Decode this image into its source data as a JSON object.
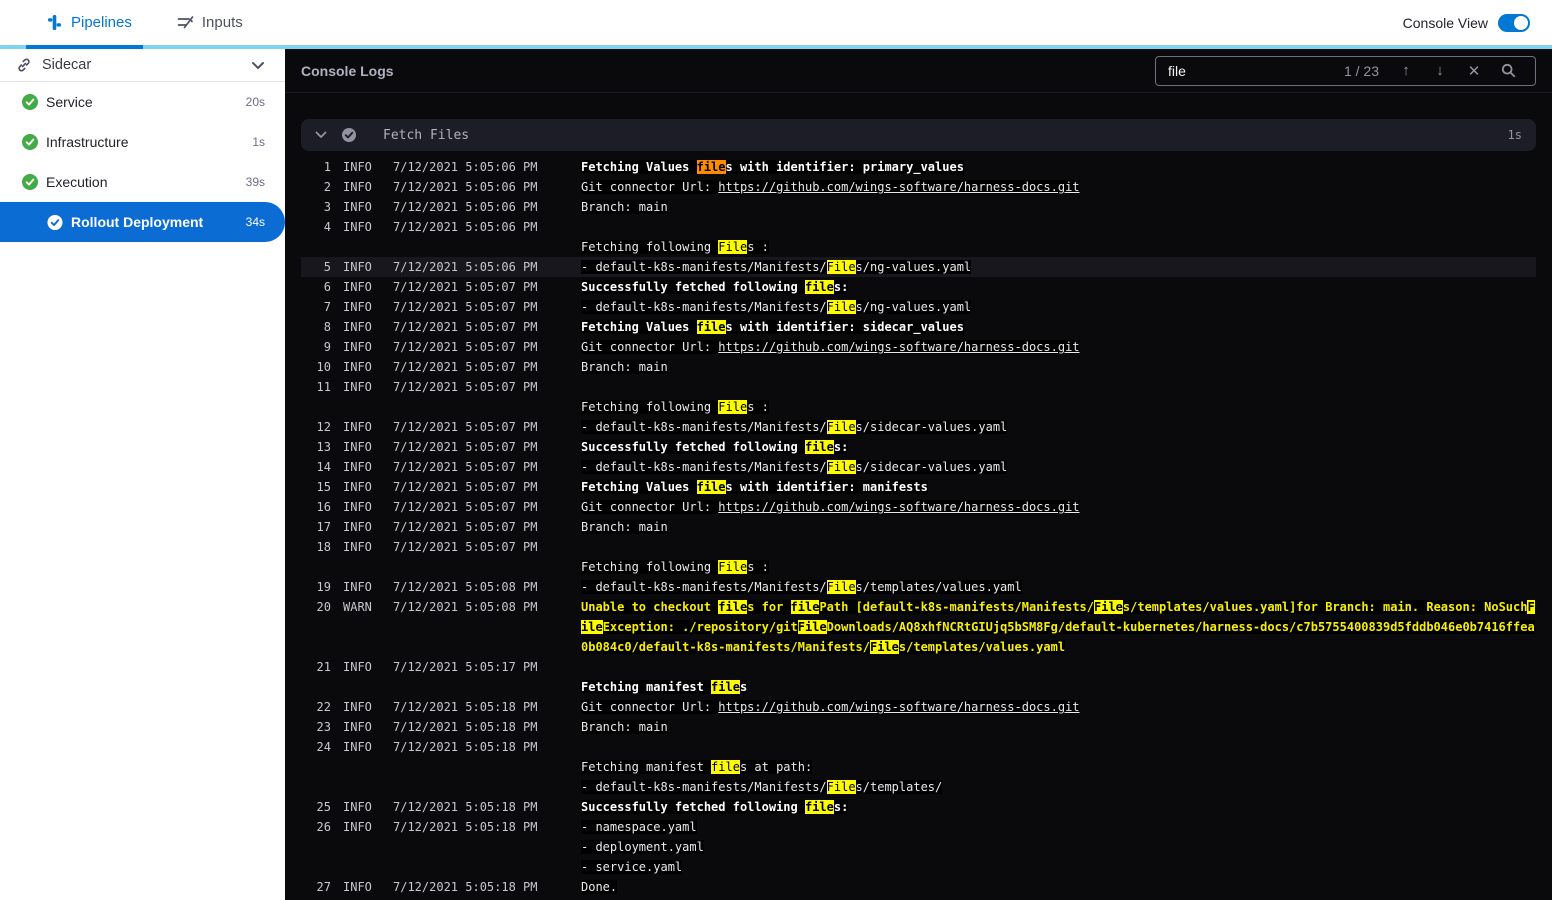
{
  "topbar": {
    "tabs": [
      {
        "label": "Pipelines",
        "active": true
      },
      {
        "label": "Inputs",
        "active": false
      }
    ],
    "console_view_label": "Console View",
    "toggle_on": true,
    "accent_color": "#0278d5",
    "stripe_color": "#7fd4f1"
  },
  "sidebar": {
    "header": {
      "label": "Sidecar"
    },
    "items": [
      {
        "label": "Service",
        "duration": "20s",
        "status": "success",
        "selected": false,
        "indent": false
      },
      {
        "label": "Infrastructure",
        "duration": "1s",
        "status": "success",
        "selected": false,
        "indent": false
      },
      {
        "label": "Execution",
        "duration": "39s",
        "status": "success",
        "selected": false,
        "indent": false
      },
      {
        "label": "Rollout Deployment",
        "duration": "34s",
        "status": "success",
        "selected": true,
        "indent": true
      }
    ],
    "success_color": "#42ab45",
    "selected_color": "#0b6cd4"
  },
  "console": {
    "title": "Console Logs",
    "search": {
      "value": "file",
      "counter": "1 / 23",
      "up_glyph": "↑",
      "down_glyph": "↓",
      "close_glyph": "✕"
    },
    "section": {
      "label": "Fetch Files",
      "duration": "1s"
    },
    "colors": {
      "match_bg": "#fdfd00",
      "current_match_bg": "#ff8b00",
      "warn_text": "#f7ee05"
    },
    "rows": [
      {
        "n": "1",
        "l": "INFO",
        "t": "7/12/2021 5:05:06 PM",
        "st": "bold",
        "segs": [
          {
            "t": "Fetching Values "
          },
          {
            "t": "file",
            "h": "cur"
          },
          {
            "t": "s with identifier: primary_values"
          }
        ]
      },
      {
        "n": "2",
        "l": "INFO",
        "t": "7/12/2021 5:05:06 PM",
        "segs": [
          {
            "t": "Git connector Url: "
          },
          {
            "t": "https://github.com/wings-software/harness-docs.git",
            "s": "link"
          }
        ]
      },
      {
        "n": "3",
        "l": "INFO",
        "t": "7/12/2021 5:05:06 PM",
        "segs": [
          {
            "t": "Branch: main"
          }
        ]
      },
      {
        "n": "4",
        "l": "INFO",
        "t": "7/12/2021 5:05:06 PM",
        "segs": []
      },
      {
        "segs": [
          {
            "t": "Fetching following "
          },
          {
            "t": "File",
            "h": "m"
          },
          {
            "t": "s :"
          }
        ]
      },
      {
        "n": "5",
        "l": "INFO",
        "t": "7/12/2021 5:05:06 PM",
        "hl": true,
        "segs": [
          {
            "t": "- default-k8s-manifests/Manifests/"
          },
          {
            "t": "File",
            "h": "m"
          },
          {
            "t": "s/ng-values.yaml"
          }
        ]
      },
      {
        "n": "6",
        "l": "INFO",
        "t": "7/12/2021 5:05:07 PM",
        "st": "bold",
        "segs": [
          {
            "t": "Successfully fetched following "
          },
          {
            "t": "file",
            "h": "m"
          },
          {
            "t": "s:"
          }
        ]
      },
      {
        "n": "7",
        "l": "INFO",
        "t": "7/12/2021 5:05:07 PM",
        "segs": [
          {
            "t": "- default-k8s-manifests/Manifests/"
          },
          {
            "t": "File",
            "h": "m"
          },
          {
            "t": "s/ng-values.yaml"
          }
        ]
      },
      {
        "n": "8",
        "l": "INFO",
        "t": "7/12/2021 5:05:07 PM",
        "st": "bold",
        "segs": [
          {
            "t": "Fetching Values "
          },
          {
            "t": "file",
            "h": "m"
          },
          {
            "t": "s with identifier: sidecar_values"
          }
        ]
      },
      {
        "n": "9",
        "l": "INFO",
        "t": "7/12/2021 5:05:07 PM",
        "segs": [
          {
            "t": "Git connector Url: "
          },
          {
            "t": "https://github.com/wings-software/harness-docs.git",
            "s": "link"
          }
        ]
      },
      {
        "n": "10",
        "l": "INFO",
        "t": "7/12/2021 5:05:07 PM",
        "segs": [
          {
            "t": "Branch: main"
          }
        ]
      },
      {
        "n": "11",
        "l": "INFO",
        "t": "7/12/2021 5:05:07 PM",
        "segs": []
      },
      {
        "segs": [
          {
            "t": "Fetching following "
          },
          {
            "t": "File",
            "h": "m"
          },
          {
            "t": "s :"
          }
        ]
      },
      {
        "n": "12",
        "l": "INFO",
        "t": "7/12/2021 5:05:07 PM",
        "segs": [
          {
            "t": "- default-k8s-manifests/Manifests/"
          },
          {
            "t": "File",
            "h": "m"
          },
          {
            "t": "s/sidecar-values.yaml"
          }
        ]
      },
      {
        "n": "13",
        "l": "INFO",
        "t": "7/12/2021 5:05:07 PM",
        "st": "bold",
        "segs": [
          {
            "t": "Successfully fetched following "
          },
          {
            "t": "file",
            "h": "m"
          },
          {
            "t": "s:"
          }
        ]
      },
      {
        "n": "14",
        "l": "INFO",
        "t": "7/12/2021 5:05:07 PM",
        "segs": [
          {
            "t": "- default-k8s-manifests/Manifests/"
          },
          {
            "t": "File",
            "h": "m"
          },
          {
            "t": "s/sidecar-values.yaml"
          }
        ]
      },
      {
        "n": "15",
        "l": "INFO",
        "t": "7/12/2021 5:05:07 PM",
        "st": "bold",
        "segs": [
          {
            "t": "Fetching Values "
          },
          {
            "t": "file",
            "h": "m"
          },
          {
            "t": "s with identifier: manifests"
          }
        ]
      },
      {
        "n": "16",
        "l": "INFO",
        "t": "7/12/2021 5:05:07 PM",
        "segs": [
          {
            "t": "Git connector Url: "
          },
          {
            "t": "https://github.com/wings-software/harness-docs.git",
            "s": "link"
          }
        ]
      },
      {
        "n": "17",
        "l": "INFO",
        "t": "7/12/2021 5:05:07 PM",
        "segs": [
          {
            "t": "Branch: main"
          }
        ]
      },
      {
        "n": "18",
        "l": "INFO",
        "t": "7/12/2021 5:05:07 PM",
        "segs": []
      },
      {
        "segs": [
          {
            "t": "Fetching following "
          },
          {
            "t": "File",
            "h": "m"
          },
          {
            "t": "s :"
          }
        ]
      },
      {
        "n": "19",
        "l": "INFO",
        "t": "7/12/2021 5:05:08 PM",
        "segs": [
          {
            "t": "- default-k8s-manifests/Manifests/"
          },
          {
            "t": "File",
            "h": "m"
          },
          {
            "t": "s/templates/values.yaml"
          }
        ]
      },
      {
        "n": "20",
        "l": "WARN",
        "t": "7/12/2021 5:05:08 PM",
        "st": "warn",
        "segs": [
          {
            "t": "Unable to checkout "
          },
          {
            "t": "file",
            "h": "m"
          },
          {
            "t": "s for "
          },
          {
            "t": "file",
            "h": "m"
          },
          {
            "t": "Path [default-k8s-manifests/Manifests/"
          },
          {
            "t": "File",
            "h": "m"
          },
          {
            "t": "s/templates/values.yaml]for Branch: main. Reason: NoSuch"
          },
          {
            "t": "F",
            "h": "m"
          }
        ]
      },
      {
        "st": "warn",
        "segs": [
          {
            "t": "ile",
            "h": "m"
          },
          {
            "t": "Exception: ./repository/git"
          },
          {
            "t": "File",
            "h": "m"
          },
          {
            "t": "Downloads/AQ8xhfNCRtGIUjq5bSM8Fg/default-kubernetes/harness-docs/c7b5755400839d5fddb046e0b7416ffea"
          }
        ]
      },
      {
        "st": "warn",
        "segs": [
          {
            "t": "0b084c0/default-k8s-manifests/Manifests/"
          },
          {
            "t": "File",
            "h": "m"
          },
          {
            "t": "s/templates/values.yaml"
          }
        ]
      },
      {
        "n": "21",
        "l": "INFO",
        "t": "7/12/2021 5:05:17 PM",
        "segs": []
      },
      {
        "st": "bold",
        "segs": [
          {
            "t": "Fetching manifest "
          },
          {
            "t": "file",
            "h": "m"
          },
          {
            "t": "s"
          }
        ]
      },
      {
        "n": "22",
        "l": "INFO",
        "t": "7/12/2021 5:05:18 PM",
        "segs": [
          {
            "t": "Git connector Url: "
          },
          {
            "t": "https://github.com/wings-software/harness-docs.git",
            "s": "link"
          }
        ]
      },
      {
        "n": "23",
        "l": "INFO",
        "t": "7/12/2021 5:05:18 PM",
        "segs": [
          {
            "t": "Branch: main"
          }
        ]
      },
      {
        "n": "24",
        "l": "INFO",
        "t": "7/12/2021 5:05:18 PM",
        "segs": []
      },
      {
        "segs": [
          {
            "t": "Fetching manifest "
          },
          {
            "t": "file",
            "h": "m"
          },
          {
            "t": "s at path:"
          }
        ]
      },
      {
        "segs": [
          {
            "t": "- default-k8s-manifests/Manifests/"
          },
          {
            "t": "File",
            "h": "m"
          },
          {
            "t": "s/templates/"
          }
        ]
      },
      {
        "n": "25",
        "l": "INFO",
        "t": "7/12/2021 5:05:18 PM",
        "st": "bold",
        "segs": [
          {
            "t": "Successfully fetched following "
          },
          {
            "t": "file",
            "h": "m"
          },
          {
            "t": "s:"
          }
        ]
      },
      {
        "n": "26",
        "l": "INFO",
        "t": "7/12/2021 5:05:18 PM",
        "segs": [
          {
            "t": "- namespace.yaml"
          }
        ]
      },
      {
        "segs": [
          {
            "t": "- deployment.yaml"
          }
        ]
      },
      {
        "segs": [
          {
            "t": "- service.yaml"
          }
        ]
      },
      {
        "n": "27",
        "l": "INFO",
        "t": "7/12/2021 5:05:18 PM",
        "segs": [
          {
            "t": "Done."
          }
        ]
      }
    ]
  }
}
